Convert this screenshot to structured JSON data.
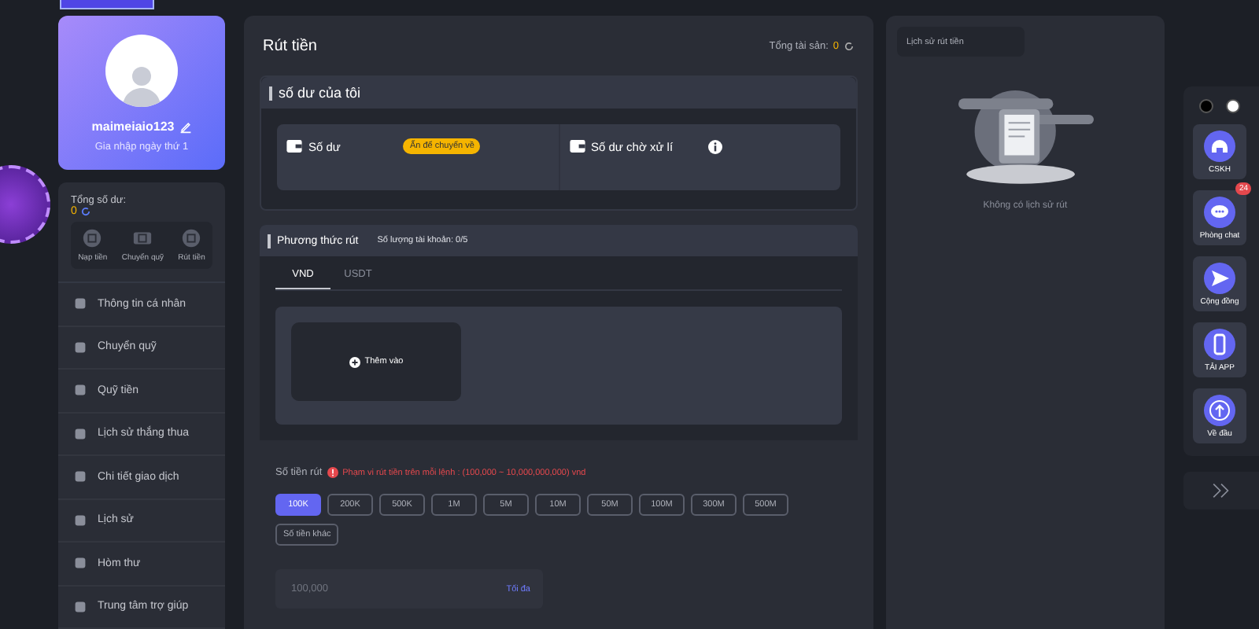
{
  "top_nav": {
    "active_tab": true
  },
  "profile": {
    "username": "maimeiaio123",
    "joined": "Gia nhập ngày thứ 1"
  },
  "balance": {
    "label": "Tổng số dư:",
    "value": "0"
  },
  "quick_actions": [
    {
      "label": "Nạp tiền"
    },
    {
      "label": "Chuyển quỹ"
    },
    {
      "label": "Rút tiền"
    }
  ],
  "menu": [
    {
      "label": "Thông tin cá nhân"
    },
    {
      "label": "Chuyển quỹ"
    },
    {
      "label": "Quỹ tiền"
    },
    {
      "label": "Lịch sử thắng thua"
    },
    {
      "label": "Chi tiết giao dịch"
    },
    {
      "label": "Lịch sử"
    },
    {
      "label": "Hòm thư"
    },
    {
      "label": "Trung tâm trợ giúp"
    }
  ],
  "page": {
    "title": "Rút tiền",
    "assets_label": "Tổng tài sản:",
    "assets_value": "0"
  },
  "my_balance": {
    "title": "số dư của tôi",
    "balance_label": "Số dư",
    "transfer_badge": "Ấn để chuyển về",
    "pending_label": "Số dư chờ xử lí"
  },
  "method": {
    "title": "Phương thức rút",
    "account_count_label": "Số lượng tài khoản:",
    "account_count": "0/5",
    "tabs": [
      {
        "label": "VND",
        "selected": true
      },
      {
        "label": "USDT",
        "selected": false
      }
    ],
    "add_label": "Thêm vào"
  },
  "amount": {
    "label": "Số tiền rút",
    "range_note": "Phạm vi rút tiền trên mỗi lệnh : (100,000 ~ 10,000,000,000) vnd",
    "presets": [
      {
        "label": "100K",
        "selected": true
      },
      {
        "label": "200K",
        "selected": false
      },
      {
        "label": "500K",
        "selected": false
      },
      {
        "label": "1M",
        "selected": false
      },
      {
        "label": "5M",
        "selected": false
      },
      {
        "label": "10M",
        "selected": false
      },
      {
        "label": "50M",
        "selected": false
      },
      {
        "label": "100M",
        "selected": false
      },
      {
        "label": "300M",
        "selected": false
      },
      {
        "label": "500M",
        "selected": false
      },
      {
        "label": "Số tiền khác",
        "selected": false
      }
    ],
    "placeholder": "100,000",
    "max_label": "Tối đa"
  },
  "history": {
    "tab": "Lịch sử rút tiền",
    "empty": "Không có lịch sử rút"
  },
  "floating_bar": {
    "themes": [
      {
        "color": "#000000"
      },
      {
        "color": "#ffffff"
      }
    ],
    "items": [
      {
        "kind": "headset",
        "label": "CSKH"
      },
      {
        "kind": "chat",
        "label": "Phòng chat",
        "badge": "24"
      },
      {
        "kind": "send",
        "label": "Cộng đồng"
      },
      {
        "kind": "phone",
        "label": "TẢI APP"
      },
      {
        "kind": "up",
        "label": "Về đầu"
      }
    ]
  }
}
